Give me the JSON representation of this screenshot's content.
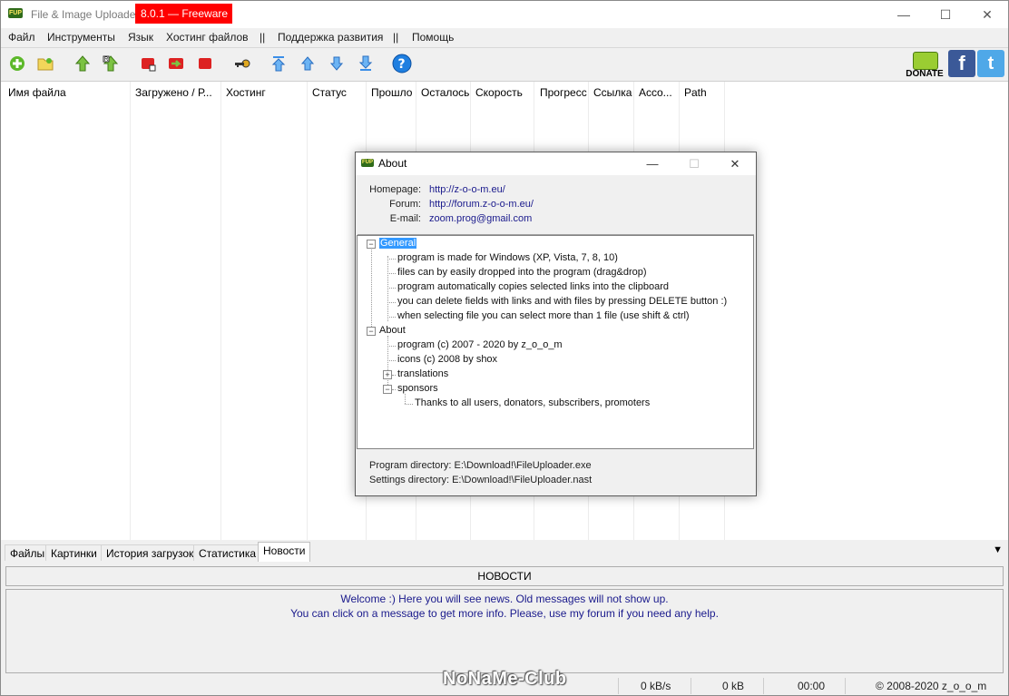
{
  "window": {
    "title": "File & Image Uploader",
    "title_badge": "8.0.1 — Freeware",
    "minimize": "—",
    "maximize": "☐",
    "close": "✕"
  },
  "menu": [
    "Файл",
    "Инструменты",
    "Язык",
    "Хостинг файлов",
    "||",
    "Поддержка развития",
    "||",
    "Помощь"
  ],
  "toolbar": {
    "donate_label": "DONATE",
    "facebook": "f",
    "twitter": "t",
    "icons": [
      "add-icon",
      "open-folder-icon",
      "upload-icon",
      "upload-all-icon",
      "stop-icon",
      "stop-transfer-icon",
      "stop-all-icon",
      "key-icon",
      "move-top-icon",
      "move-up-icon",
      "move-down-icon",
      "move-bottom-icon",
      "help-icon"
    ]
  },
  "columns": [
    "Имя файла",
    "Загружено / Р...",
    "Хостинг",
    "Статус",
    "Прошло",
    "Осталось",
    "Скорость",
    "Прогресс",
    "Ссылка",
    "Acco...",
    "Path"
  ],
  "tabs": [
    "Файлы",
    "Картинки",
    "История загрузок",
    "Статистика",
    "Новости"
  ],
  "active_tab": "Новости",
  "news": {
    "header": "НОВОСТИ",
    "lines": [
      "Welcome :) Here you will see news. Old messages will not show up.",
      "You can click on a message to get more info. Please, use my forum if you need any help."
    ]
  },
  "status": {
    "speed": "0 kB/s",
    "size": "0 kB",
    "time": "00:00",
    "copyright": "© 2008-2020 z_o_o_m"
  },
  "watermark": "NoNaMe-Club",
  "about": {
    "title": "About",
    "homepage_label": "Homepage:",
    "homepage": "http://z-o-o-m.eu/",
    "forum_label": "Forum:",
    "forum": "http://forum.z-o-o-m.eu/",
    "email_label": "E-mail:",
    "email": "zoom.prog@gmail.com",
    "tree": {
      "general": "General",
      "general_items": [
        "program is made for Windows (XP, Vista, 7, 8, 10)",
        "files can by easily dropped into the program (drag&drop)",
        "program automatically copies selected links into the clipboard",
        "you can delete fields with links and with files by pressing DELETE button :)",
        "when selecting file you can select more than 1 file (use shift & ctrl)"
      ],
      "about": "About",
      "about_items": [
        "program (c) 2007 - 2020 by z_o_o_m",
        "icons (c) 2008 by shox"
      ],
      "translations": "translations",
      "sponsors": "sponsors",
      "sponsors_items": [
        "Thanks to all users, donators, subscribers, promoters"
      ]
    },
    "program_directory": "Program directory: E:\\Download!\\FileUploader.exe",
    "settings_directory": "Settings directory: E:\\Download!\\FileUploader.nast"
  }
}
